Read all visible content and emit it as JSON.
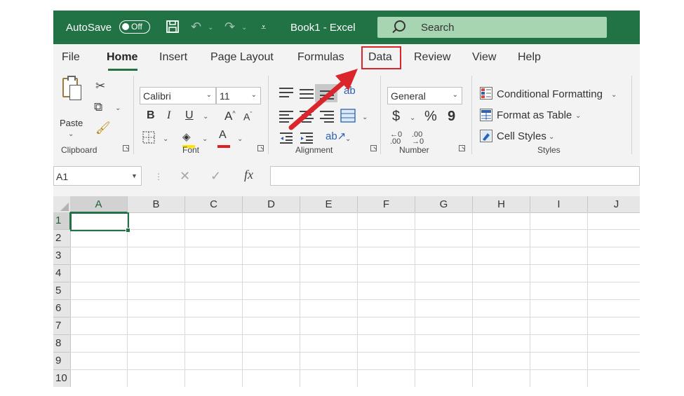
{
  "titlebar": {
    "autosave_label": "AutoSave",
    "autosave_state": "Off",
    "title": "Book1  -  Excel",
    "search_placeholder": "Search",
    "color": "#217346"
  },
  "ribbon": {
    "tabs": [
      "File",
      "Home",
      "Insert",
      "Page Layout",
      "Formulas",
      "Data",
      "Review",
      "View",
      "Help"
    ],
    "active_tab": "Home",
    "highlighted_tab": "Data",
    "clipboard": {
      "paste_label": "Paste",
      "group_label": "Clipboard"
    },
    "font": {
      "font_name": "Calibri",
      "font_size": "11",
      "bold": "B",
      "italic": "I",
      "underline": "U",
      "grow": "A",
      "shrink": "A",
      "font_color_glyph": "A",
      "group_label": "Font"
    },
    "alignment": {
      "group_label": "Alignment"
    },
    "number": {
      "format": "General",
      "currency": "$",
      "percent": "%",
      "comma": "9",
      "group_label": "Number"
    },
    "styles": {
      "conditional_formatting": "Conditional Formatting",
      "format_as_table": "Format as Table",
      "cell_styles": "Cell Styles",
      "group_label": "Styles"
    }
  },
  "formula_bar": {
    "name_box": "A1",
    "formula": ""
  },
  "grid": {
    "columns": [
      "A",
      "B",
      "C",
      "D",
      "E",
      "F",
      "G",
      "H",
      "I",
      "J"
    ],
    "rows": [
      "1",
      "2",
      "3",
      "4",
      "5",
      "6",
      "7",
      "8",
      "9",
      "10"
    ],
    "selected_cell": "A1"
  },
  "annotation": {
    "highlight_color": "#d9252b",
    "arrow_target": "Data tab"
  }
}
